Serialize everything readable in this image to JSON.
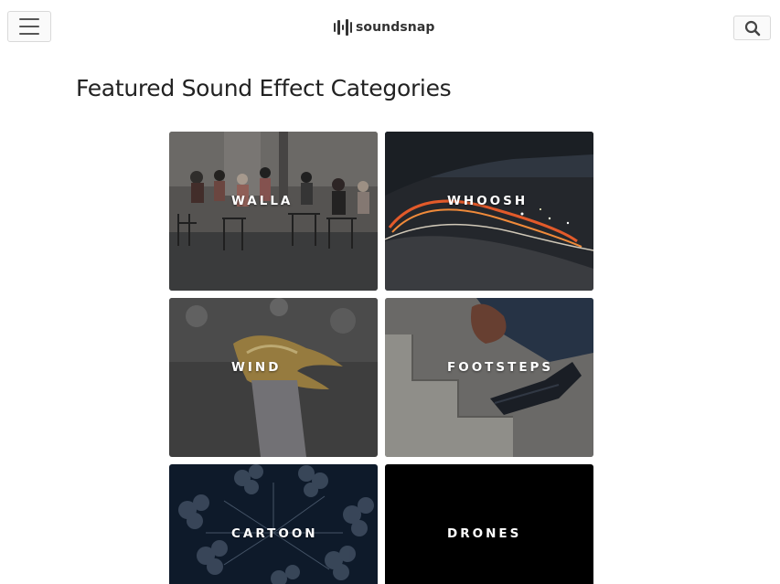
{
  "header": {
    "menu_icon": "hamburger-menu-icon",
    "logo_text": "soundsnap",
    "search_icon": "search-icon"
  },
  "main": {
    "title": "Featured Sound Effect Categories",
    "categories": [
      {
        "label": "WALLA"
      },
      {
        "label": "WHOOSH"
      },
      {
        "label": "WIND"
      },
      {
        "label": "FOOTSTEPS"
      },
      {
        "label": "CARTOON"
      },
      {
        "label": "DRONES"
      }
    ]
  },
  "colors": {
    "text": "#222222",
    "border": "#d9d9d9",
    "logo": "#333333"
  }
}
